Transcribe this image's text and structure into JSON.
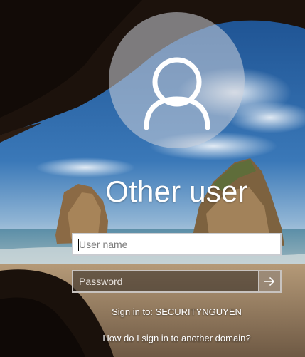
{
  "user": {
    "display_name": "Other user"
  },
  "login": {
    "username_placeholder": "User name",
    "password_placeholder": "Password",
    "sign_in_to": "Sign in to: SECURITYNGUYEN",
    "help_link": "How do I sign in to another domain?"
  },
  "icons": {
    "avatar": "user-silhouette-icon",
    "submit": "arrow-right-icon"
  }
}
